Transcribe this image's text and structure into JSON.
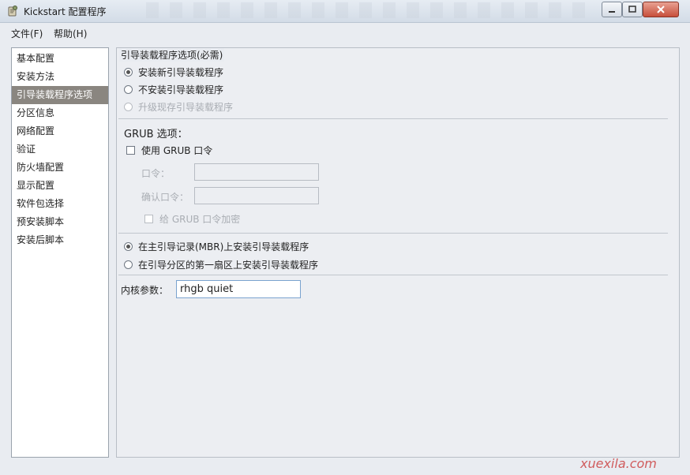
{
  "window": {
    "title": "Kickstart 配置程序"
  },
  "menu": {
    "items": [
      "文件(F)",
      "帮助(H)"
    ]
  },
  "sidebar": {
    "items": [
      {
        "label": "基本配置"
      },
      {
        "label": "安装方法"
      },
      {
        "label": "引导装载程序选项"
      },
      {
        "label": "分区信息"
      },
      {
        "label": "网络配置"
      },
      {
        "label": "验证"
      },
      {
        "label": "防火墙配置"
      },
      {
        "label": "显示配置"
      },
      {
        "label": "软件包选择"
      },
      {
        "label": "预安装脚本"
      },
      {
        "label": "安装后脚本"
      }
    ],
    "active": "引导装载程序选项"
  },
  "bootloader": {
    "group_label": "引导装载程序选项(必需)",
    "install_new": "安装新引导装载程序",
    "no_install": "不安装引导装载程序",
    "upgrade_existing": "升级现存引导装载程序",
    "selected": "安装新引导装载程序"
  },
  "grub": {
    "heading": "GRUB 选项：",
    "use_password": "使用 GRUB 口令",
    "password_label": "口令：",
    "confirm_label": "确认口令：",
    "encrypt_label": "给 GRUB 口令加密"
  },
  "install_location": {
    "mbr": "在主引导记录(MBR)上安装引导装载程序",
    "partition": "在引导分区的第一扇区上安装引导装载程序",
    "selected": "mbr"
  },
  "kernel": {
    "label": "内核参数：",
    "value": "rhgb quiet"
  },
  "watermark": "xuexila.com",
  "colors": {
    "active_item_bg": "#8a8680",
    "input_border": "#7aa3cf"
  },
  "icons": {
    "window": "kickstart-app-icon",
    "minimize": "minimize-icon",
    "maximize": "maximize-icon",
    "close": "close-icon"
  }
}
